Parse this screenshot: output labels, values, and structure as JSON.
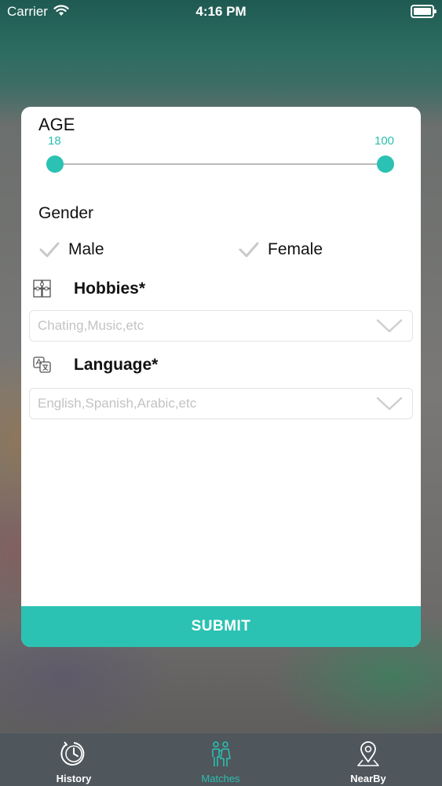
{
  "status_bar": {
    "carrier": "Carrier",
    "time": "4:16 PM"
  },
  "filter": {
    "age": {
      "label": "AGE",
      "min": "18",
      "max": "100"
    },
    "gender": {
      "label": "Gender",
      "options": [
        "Male",
        "Female"
      ]
    },
    "hobbies": {
      "label": "Hobbies*",
      "placeholder": "Chating,Music,etc"
    },
    "language": {
      "label": "Language*",
      "placeholder": "English,Spanish,Arabic,etc"
    },
    "submit_label": "SUBMIT"
  },
  "tab_bar": {
    "tabs": [
      {
        "label": "History",
        "icon": "history-clock-icon"
      },
      {
        "label": "Matches",
        "icon": "matches-couple-icon"
      },
      {
        "label": "NearBy",
        "icon": "location-pin-icon"
      }
    ],
    "active": "Matches"
  },
  "colors": {
    "accent": "#2bc1b3",
    "tab_bar": "#4f565c",
    "placeholder": "#c3c3c3"
  }
}
